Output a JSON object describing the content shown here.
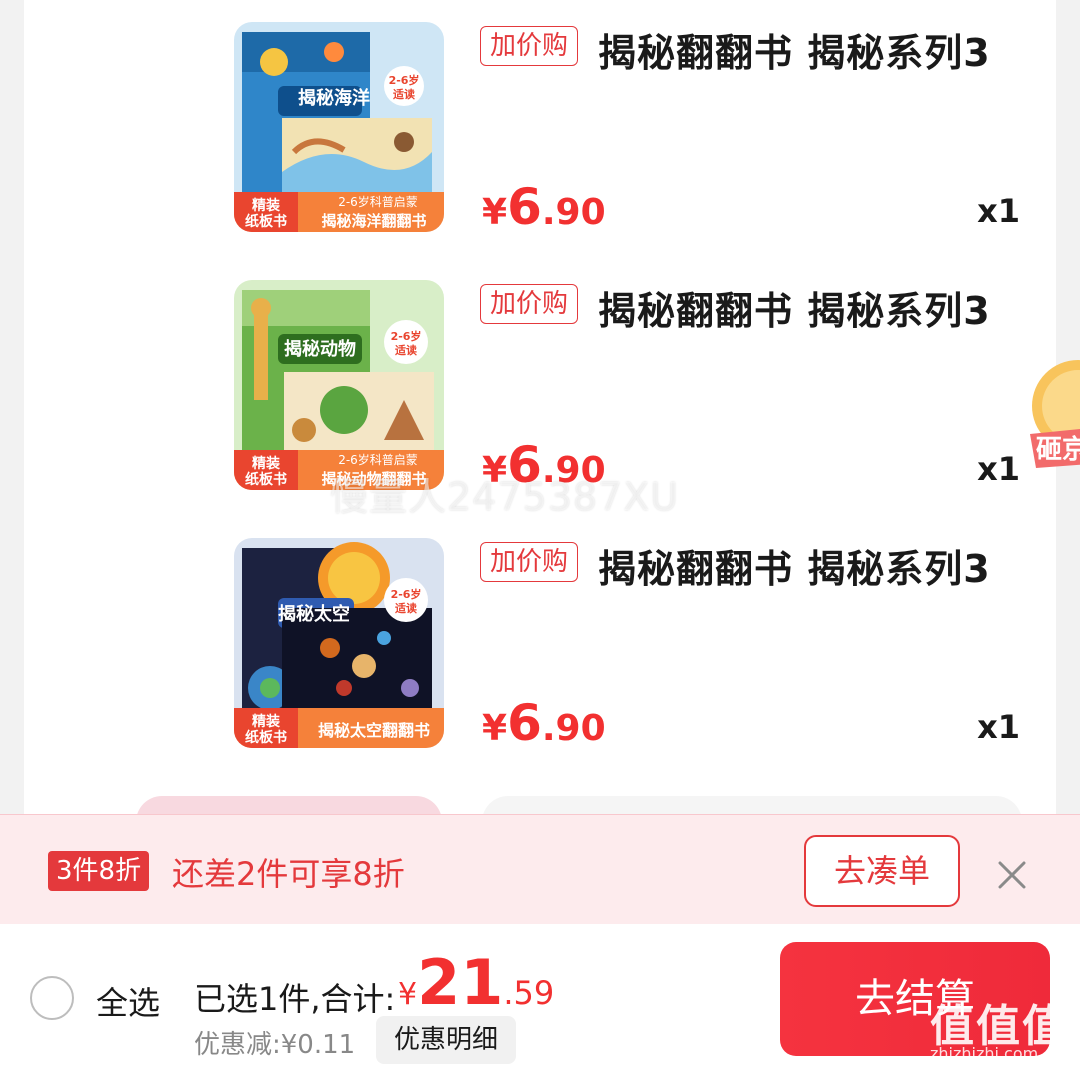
{
  "items": [
    {
      "tag": "加价购",
      "title": "揭秘翻翻书 揭秘系列3",
      "price_currency": "¥",
      "price_int": "6",
      "price_dec": ".90",
      "quantity": "x1",
      "cover": {
        "brand": "精装",
        "label": "纸板书",
        "book_title": "揭秘海洋",
        "age": "2-6岁",
        "age2": "适读",
        "subtitle": "2-6岁科普启蒙",
        "caption": "揭秘海洋翻翻书",
        "theme_color": "#2f86c9"
      }
    },
    {
      "tag": "加价购",
      "title": "揭秘翻翻书 揭秘系列3",
      "price_currency": "¥",
      "price_int": "6",
      "price_dec": ".90",
      "quantity": "x1",
      "cover": {
        "brand": "精装",
        "label": "纸板书",
        "book_title": "揭秘动物",
        "age": "2-6岁",
        "age2": "适读",
        "subtitle": "2-6岁科普启蒙",
        "caption": "揭秘动物翻翻书",
        "theme_color": "#6bb24a"
      }
    },
    {
      "tag": "加价购",
      "title": "揭秘翻翻书 揭秘系列3",
      "price_currency": "¥",
      "price_int": "6",
      "price_dec": ".90",
      "quantity": "x1",
      "cover": {
        "brand": "精装",
        "label": "纸板书",
        "book_title": "揭秘太空",
        "age": "2-6岁",
        "age2": "适读",
        "subtitle": "",
        "caption": "揭秘太空翻翻书",
        "theme_color": "#1c2240"
      }
    }
  ],
  "watermark": "慢量人2475387XU",
  "side_float": "砸京",
  "promo": {
    "badge": "3件8折",
    "text": "还差2件可享8折",
    "button": "去凑单"
  },
  "bottom": {
    "select_all": "全选",
    "selected_text": "已选1件,合计:",
    "total_currency": "¥",
    "total_int": "21",
    "total_dec": ".59",
    "discount": "优惠减:¥0.11",
    "detail_button": "优惠明细",
    "checkout": "去结算"
  },
  "logo": {
    "glyphs": "值值值",
    "site": "zhizhizhi.com"
  },
  "colors": {
    "accent": "#e4393c",
    "price": "#f23030"
  }
}
